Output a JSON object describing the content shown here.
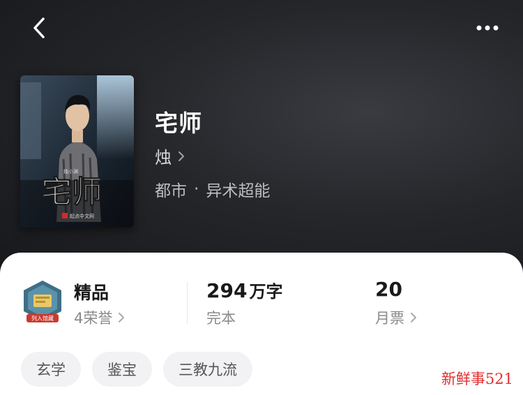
{
  "book": {
    "title": "宅师",
    "author": "烛",
    "genre_main": "都市",
    "genre_sub": "异术超能",
    "cover_title": "宅师",
    "cover_author": "烛小渊",
    "cover_publisher": "起点中文网"
  },
  "stats": {
    "quality_label": "精品",
    "honors_label": "4荣誉",
    "badge_text": "列入馆藏",
    "word_count": "294",
    "word_unit": "万字",
    "status": "完本",
    "monthly_tickets": "20",
    "monthly_tickets_label": "月票"
  },
  "tags": [
    "玄学",
    "鉴宝",
    "三教九流"
  ],
  "watermark": "新鲜事521",
  "icons": {
    "back": "chevron-left-icon",
    "more": "more-dots-icon",
    "badge": "collection-badge-icon"
  },
  "colors": {
    "hero_bg": "#25262a",
    "card_bg": "#ffffff",
    "tag_bg": "#f2f2f4",
    "watermark": "#e02f2f"
  }
}
